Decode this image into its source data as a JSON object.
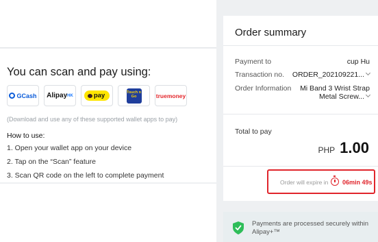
{
  "payment_methods": {
    "title": "You can scan and pay using:",
    "wallets": [
      {
        "name": "GCash"
      },
      {
        "name": "Alipay",
        "suffix": "HK"
      },
      {
        "name": "pay"
      },
      {
        "name": "Touch 'n Go eWallet",
        "short": "Touch n Go"
      },
      {
        "name": "truemoney"
      }
    ],
    "download_note": "(Download and use any of these supported wallet apps to pay)",
    "how_to_title": "How to use:",
    "steps": [
      "1. Open your wallet app on your device",
      "2. Tap on the “Scan” feature",
      "3. Scan QR code on the left to complete payment"
    ]
  },
  "order_summary": {
    "title": "Order summary",
    "rows": [
      {
        "label": "Payment to",
        "value": "cup Hu"
      },
      {
        "label": "Transaction no.",
        "value": "ORDER_202109221..."
      },
      {
        "label": "Order Information",
        "value_line1": "Mi Band 3 Wrist Strap",
        "value_line2": "Metal Screw..."
      }
    ],
    "total_label": "Total to pay",
    "currency": "PHP",
    "amount": "1.00",
    "expire_label": "Order will expire in",
    "countdown": "06min 49s"
  },
  "secure_banner": {
    "text": "Payments are processed securely within Alipay+™"
  },
  "colors": {
    "alert_red": "#e0242b",
    "shield_green": "#2ebd59",
    "background": "#eef0f2"
  }
}
